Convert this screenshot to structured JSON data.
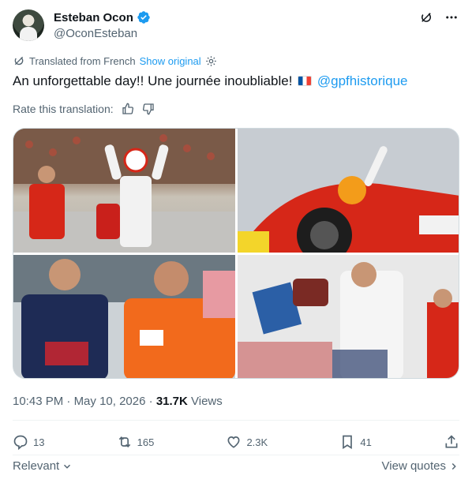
{
  "author": {
    "name": "Esteban Ocon",
    "handle": "@OconEsteban"
  },
  "translation": {
    "notice": "Translated from French",
    "show_original": "Show original"
  },
  "tweet": {
    "text": "An unforgettable day!! Une journée inoubliable!",
    "mention": "@gpfhistorique"
  },
  "rate": {
    "label": "Rate this translation:"
  },
  "meta": {
    "time": "10:43 PM",
    "separator": "·",
    "date": "May 10, 2026",
    "views_count": "31.7K",
    "views_label": "Views"
  },
  "actions": {
    "replies": "13",
    "reposts": "165",
    "likes": "2.3K",
    "bookmarks": "41"
  },
  "footer": {
    "relevant": "Relevant",
    "view_quotes": "View quotes"
  },
  "media": {
    "image_1": "Driver in white race suit with arms raised, crowd and team members in red",
    "image_2": "Red Ferrari F1 car with driver in orange helmet waving",
    "image_3": "Drivers in Red Bull and orange racing suits smiling",
    "image_4": "Driver signing autographs for fans"
  },
  "colors": {
    "accent": "#1d9bf0",
    "text": "#0f1419",
    "secondary": "#536471",
    "ferrari_red": "#d62718"
  }
}
